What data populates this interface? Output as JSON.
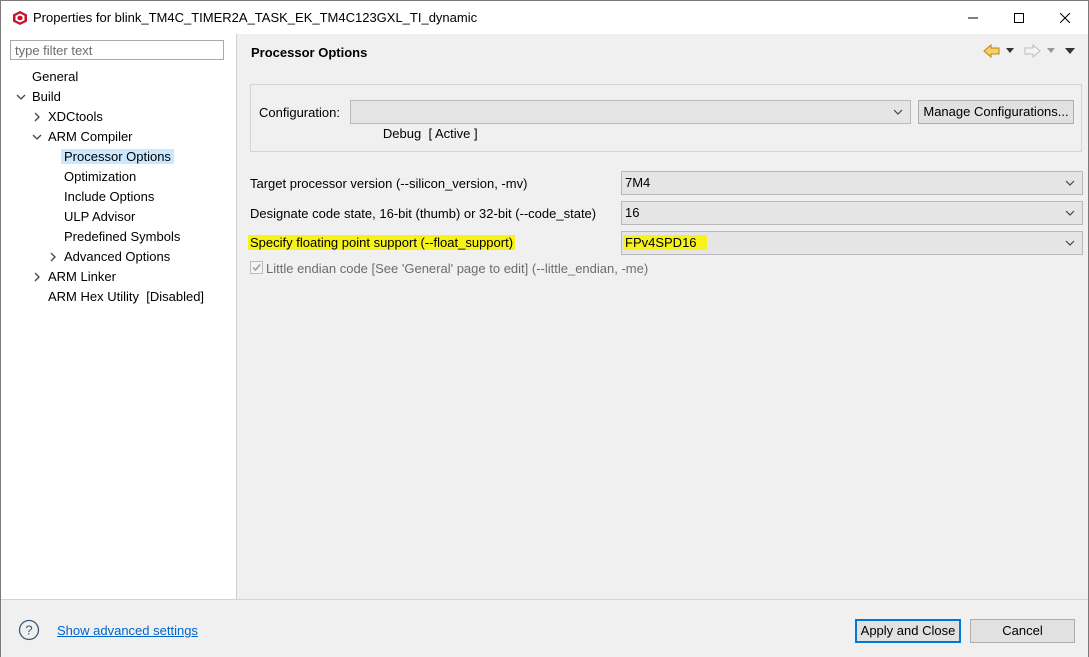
{
  "window": {
    "title": "Properties for blink_TM4C_TIMER2A_TASK_EK_TM4C123GXL_TI_dynamic",
    "icon": "ti-logo-icon"
  },
  "filter": {
    "placeholder": "type filter text",
    "value": ""
  },
  "tree": {
    "general": "General",
    "build": "Build",
    "xdctools": "XDCtools",
    "arm_compiler": "ARM Compiler",
    "processor_options": "Processor Options",
    "optimization": "Optimization",
    "include_options": "Include Options",
    "ulp_advisor": "ULP Advisor",
    "predefined_symbols": "Predefined Symbols",
    "advanced_options": "Advanced Options",
    "arm_linker": "ARM Linker",
    "arm_hex_utility": "ARM Hex Utility  [Disabled]"
  },
  "page": {
    "title": "Processor Options",
    "configuration_label": "Configuration:",
    "configuration_value": "Debug  [ Active ]",
    "manage_configurations": "Manage Configurations...",
    "options": [
      {
        "label": "Target processor version (--silicon_version, -mv)",
        "value": "7M4",
        "highlight": false
      },
      {
        "label": "Designate code state, 16-bit (thumb) or 32-bit (--code_state)",
        "value": "16",
        "highlight": false
      },
      {
        "label": "Specify floating point support (--float_support)",
        "value": "FPv4SPD16",
        "highlight": true
      }
    ],
    "little_endian": {
      "label": "Little endian code [See 'General' page to edit] (--little_endian, -me)",
      "checked": true,
      "enabled": false
    }
  },
  "footer": {
    "advanced_link": "Show advanced settings",
    "apply_close": "Apply and Close",
    "cancel": "Cancel"
  },
  "colors": {
    "highlight": "#f7f31a",
    "selection": "#cce8ff",
    "link": "#0066cc",
    "accent": "#0078d7"
  }
}
